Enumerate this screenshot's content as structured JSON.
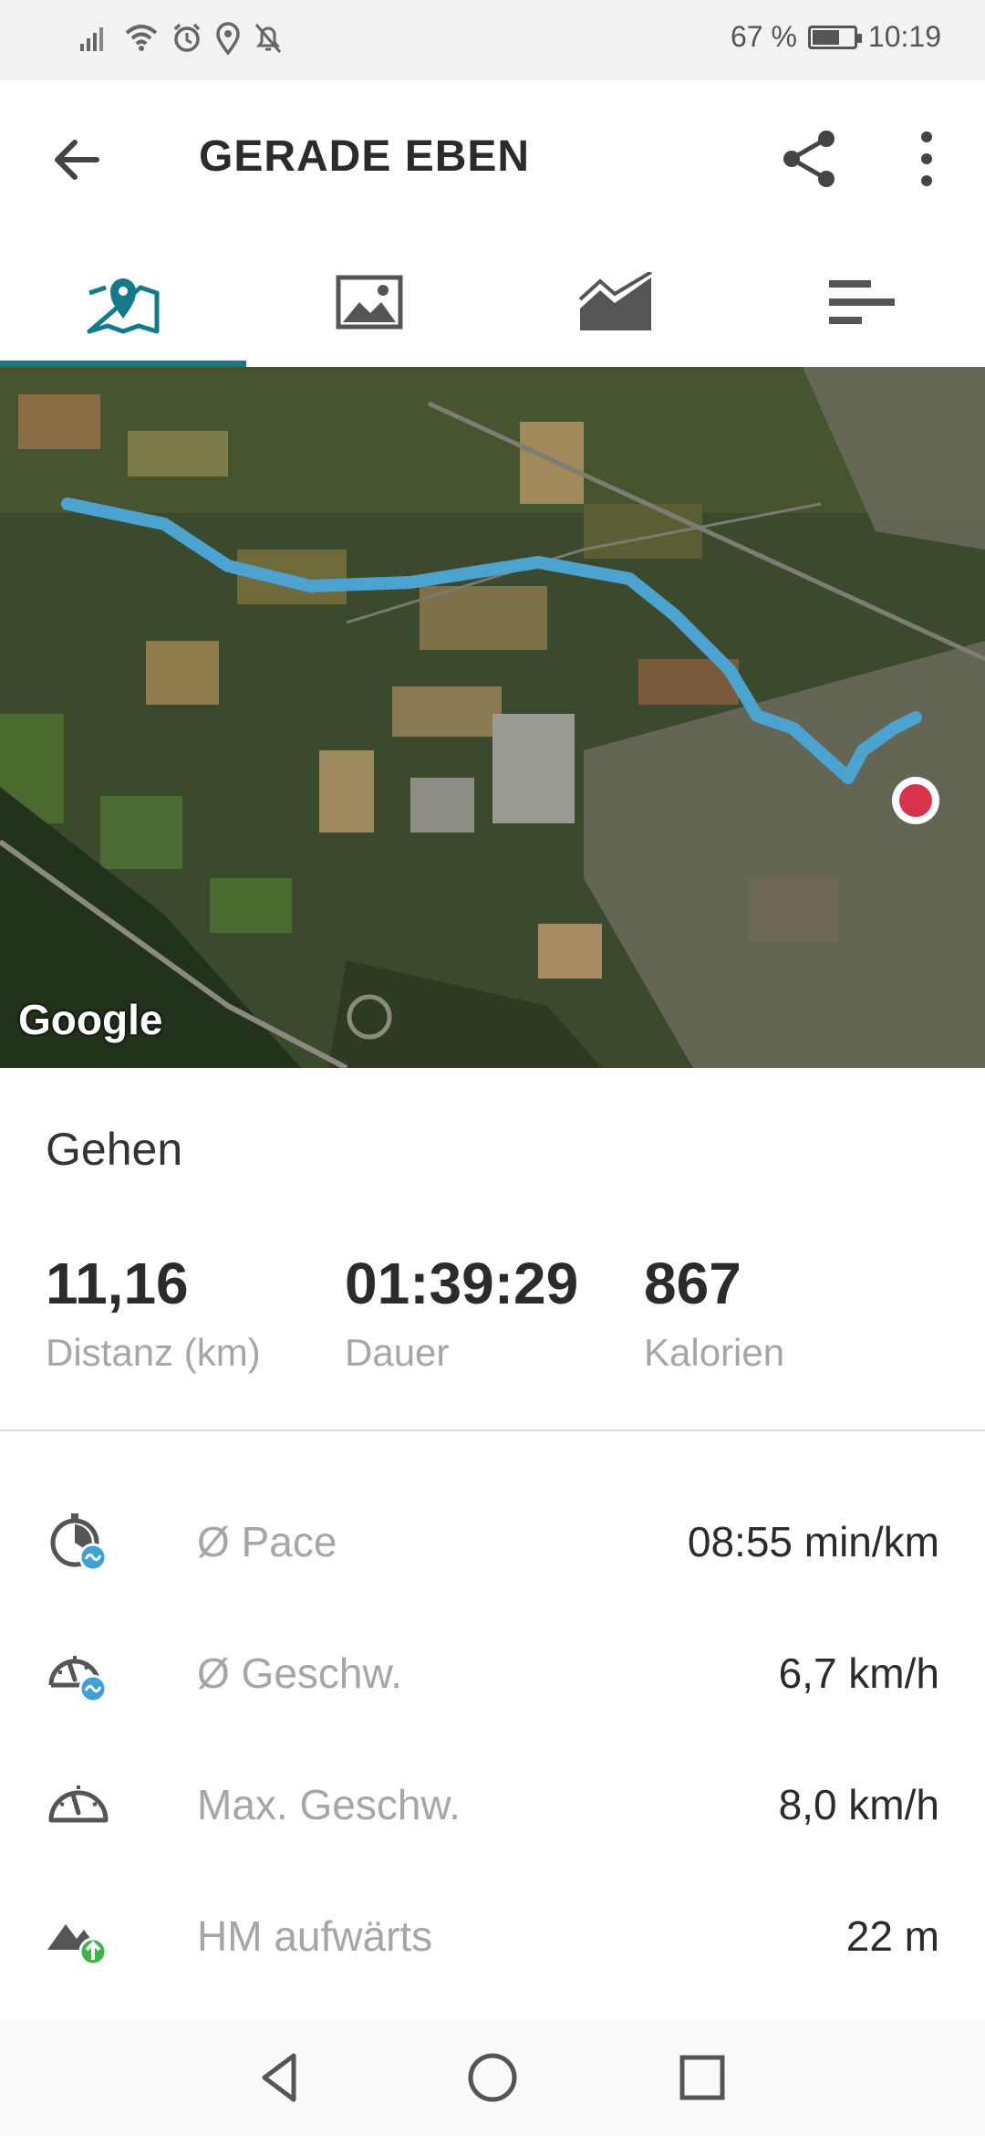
{
  "status_bar": {
    "battery_text": "67 %",
    "battery_level": 0.67,
    "time": "10:19",
    "icons": [
      "signal-icon",
      "wifi-icon",
      "alarm-icon",
      "location-icon",
      "notifications-off-icon"
    ]
  },
  "app_bar": {
    "title": "GERADE EBEN",
    "icons": [
      "back-arrow-icon",
      "share-icon",
      "more-vert-icon"
    ]
  },
  "tabs": [
    {
      "icon": "map-pin-icon",
      "active": true
    },
    {
      "icon": "image-icon",
      "active": false
    },
    {
      "icon": "chart-icon",
      "active": false
    },
    {
      "icon": "laps-icon",
      "active": false
    }
  ],
  "map": {
    "attribution": "Google",
    "route_color": "#4da3cf",
    "end_marker_color": "#d8334a"
  },
  "activity": {
    "type": "Gehen",
    "summary": [
      {
        "value": "11,16",
        "label": "Distanz (km)"
      },
      {
        "value": "01:39:29",
        "label": "Dauer"
      },
      {
        "value": "867",
        "label": "Kalorien"
      }
    ]
  },
  "stats": [
    {
      "icon": "pace-icon",
      "label": "Ø Pace",
      "value": "08:55 min/km"
    },
    {
      "icon": "avg-speed-icon",
      "label": "Ø Geschw.",
      "value": "6,7 km/h"
    },
    {
      "icon": "max-speed-icon",
      "label": "Max. Geschw.",
      "value": "8,0 km/h"
    },
    {
      "icon": "elevation-up-icon",
      "label": "HM aufwärts",
      "value": "22 m"
    }
  ],
  "colors": {
    "accent": "#147a8a",
    "muted_text": "#a6a6a6",
    "badge_blue": "#3fa0d8",
    "badge_green": "#3bb54a"
  }
}
